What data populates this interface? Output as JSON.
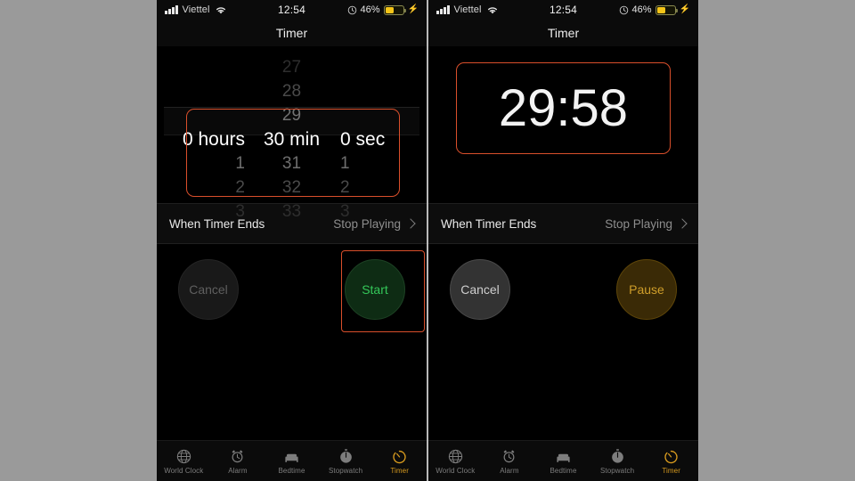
{
  "page": {
    "background_color": "#9a9a9a",
    "accent_orange": "#d79a1e",
    "annotation_color": "#d94f2b"
  },
  "status_bar": {
    "carrier": "Viettel",
    "time": "12:54",
    "battery_percent": "46%",
    "battery_level": 46,
    "wifi_icon": "wifi-icon",
    "signal_icon": "cellular-signal-icon",
    "alarm_icon": "alarm-indicator-icon",
    "charging_icon": "lightning-bolt-icon"
  },
  "nav": {
    "title": "Timer"
  },
  "panels": [
    {
      "id": "setup",
      "state": "picker",
      "picker": {
        "columns": [
          {
            "name": "hours",
            "above": [
              "",
              "",
              ""
            ],
            "selected": "0 hours",
            "below": [
              "1",
              "2",
              "3"
            ]
          },
          {
            "name": "minutes",
            "above": [
              "27",
              "28",
              "29"
            ],
            "selected": "30 min",
            "below": [
              "31",
              "32",
              "33"
            ]
          },
          {
            "name": "seconds",
            "above": [
              "",
              "",
              ""
            ],
            "selected": "0 sec",
            "below": [
              "1",
              "2",
              "3"
            ]
          }
        ]
      },
      "timer_ends": {
        "label": "When Timer Ends",
        "value": "Stop Playing",
        "chevron_icon": "chevron-right-icon"
      },
      "buttons": {
        "cancel": {
          "label": "Cancel",
          "state": "disabled"
        },
        "primary": {
          "label": "Start",
          "state": "enabled",
          "color": "#34c759"
        }
      },
      "annotations": [
        "picker-highlight-box",
        "start-button-highlight-box"
      ]
    },
    {
      "id": "running",
      "state": "countdown",
      "countdown": {
        "value": "29:58"
      },
      "timer_ends": {
        "label": "When Timer Ends",
        "value": "Stop Playing",
        "chevron_icon": "chevron-right-icon"
      },
      "buttons": {
        "cancel": {
          "label": "Cancel",
          "state": "enabled"
        },
        "primary": {
          "label": "Pause",
          "state": "enabled",
          "color": "#cf9e2a"
        }
      },
      "annotations": [
        "countdown-highlight-box"
      ]
    }
  ],
  "tab_bar": {
    "items": [
      {
        "label": "World Clock",
        "icon": "globe-icon",
        "active": false
      },
      {
        "label": "Alarm",
        "icon": "alarm-clock-icon",
        "active": false
      },
      {
        "label": "Bedtime",
        "icon": "bed-icon",
        "active": false
      },
      {
        "label": "Stopwatch",
        "icon": "stopwatch-icon",
        "active": false
      },
      {
        "label": "Timer",
        "icon": "timer-icon",
        "active": true
      }
    ]
  }
}
